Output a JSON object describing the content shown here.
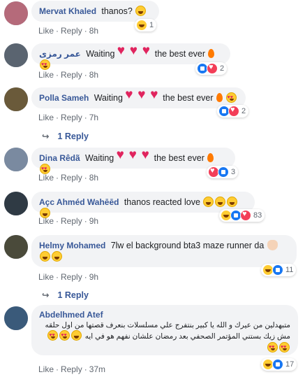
{
  "comments": [
    {
      "author": "Mervat Khaled",
      "text": "thanos?",
      "like": "Like",
      "reply": "Reply",
      "time": "8h",
      "reaction_count": "1",
      "avatar_color": "#b56a7a"
    },
    {
      "author": "عمر رمزى",
      "text": "Waiting",
      "text2": "the best ever",
      "like": "Like",
      "reply": "Reply",
      "time": "8h",
      "reaction_count": "2",
      "avatar_color": "#5a6470"
    },
    {
      "author": "Polla Sameh",
      "text": "Waiting",
      "text2": "the best ever",
      "like": "Like",
      "reply": "Reply",
      "time": "7h",
      "reaction_count": "2",
      "avatar_color": "#6a5a3a",
      "replies": "1 Reply"
    },
    {
      "author": "Dina Rêdã",
      "text": "Waiting",
      "text2": "the best ever",
      "like": "Like",
      "reply": "Reply",
      "time": "8h",
      "reaction_count": "3",
      "avatar_color": "#7a8aa0"
    },
    {
      "author": "Açc Ahméd Wahēēd",
      "text": "thanos reacted love",
      "like": "Like",
      "reply": "Reply",
      "time": "9h",
      "reaction_count": "83",
      "avatar_color": "#2f3a44"
    },
    {
      "author": "Helmy Mohamed",
      "text": "7lw el background bta3 maze runner da",
      "like": "Like",
      "reply": "Reply",
      "time": "9h",
      "reaction_count": "11",
      "avatar_color": "#4a4a3a",
      "replies": "1 Reply"
    },
    {
      "author": "Abdelhmed Atef",
      "text_line1": "متبهدلين من عيرك و الله يا كبير بنتفرج علي مسلسلات بنعرف قصتها من اول حلقه",
      "text_line2": "مش زيك بستني المؤتمر الصحفي بعد رمضان علشان نفهم هو في ايه",
      "like": "Like",
      "reply": "Reply",
      "time": "37m",
      "reaction_count": "17",
      "avatar_color": "#3a5a7a"
    }
  ],
  "colors": {
    "link": "#385898",
    "meta": "#606770",
    "bubble": "#f2f3f5"
  }
}
